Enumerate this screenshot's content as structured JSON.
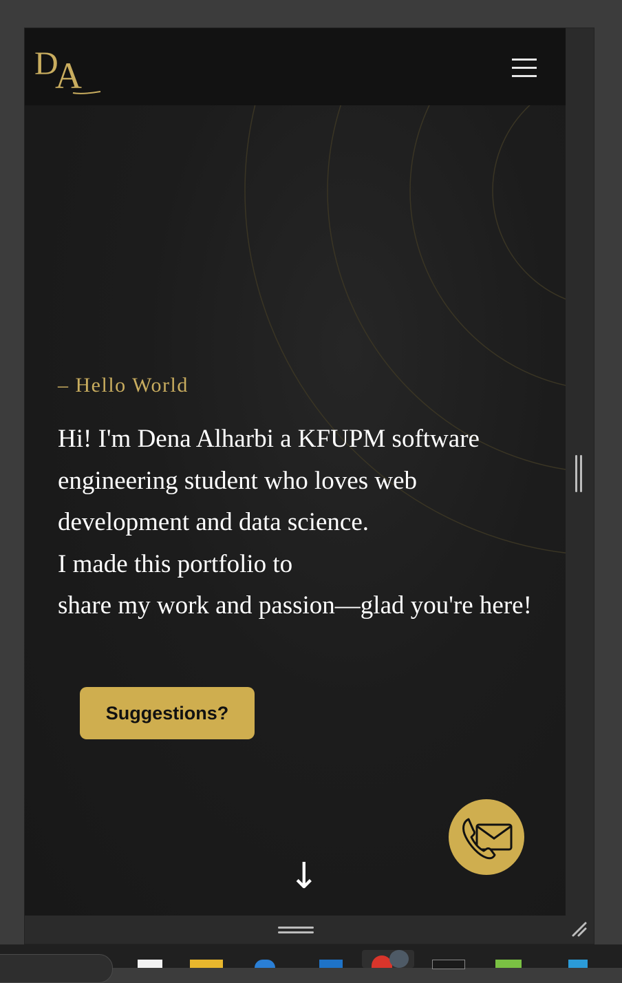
{
  "logo": {
    "letter_1": "D",
    "letter_2": "A"
  },
  "nav": {
    "menu_icon": "hamburger-menu-icon"
  },
  "hero": {
    "greeting": "– Hello World",
    "intro_line_1": "Hi! I'm Dena Alharbi a KFUPM software engineering student who loves web development and data science.",
    "intro_line_2": "I made this portfolio to",
    "intro_line_3": "share my work and passion—glad you're here!",
    "cta_label": "Suggestions?",
    "scroll_arrow": "↓",
    "contact_icon": "phone-mail-icon"
  },
  "colors": {
    "accent_gold": "#cfae4f",
    "logo_gold": "#c9ad5f",
    "background": "#1b1b1b",
    "navbar": "#121212",
    "text": "#ffffff"
  },
  "taskbar": {
    "icons": [
      "file-icon",
      "folder-icon",
      "browser-edge-icon",
      "outlook-icon",
      "chrome-icon",
      "terminal-icon",
      "app-icon",
      "vscode-icon"
    ]
  }
}
